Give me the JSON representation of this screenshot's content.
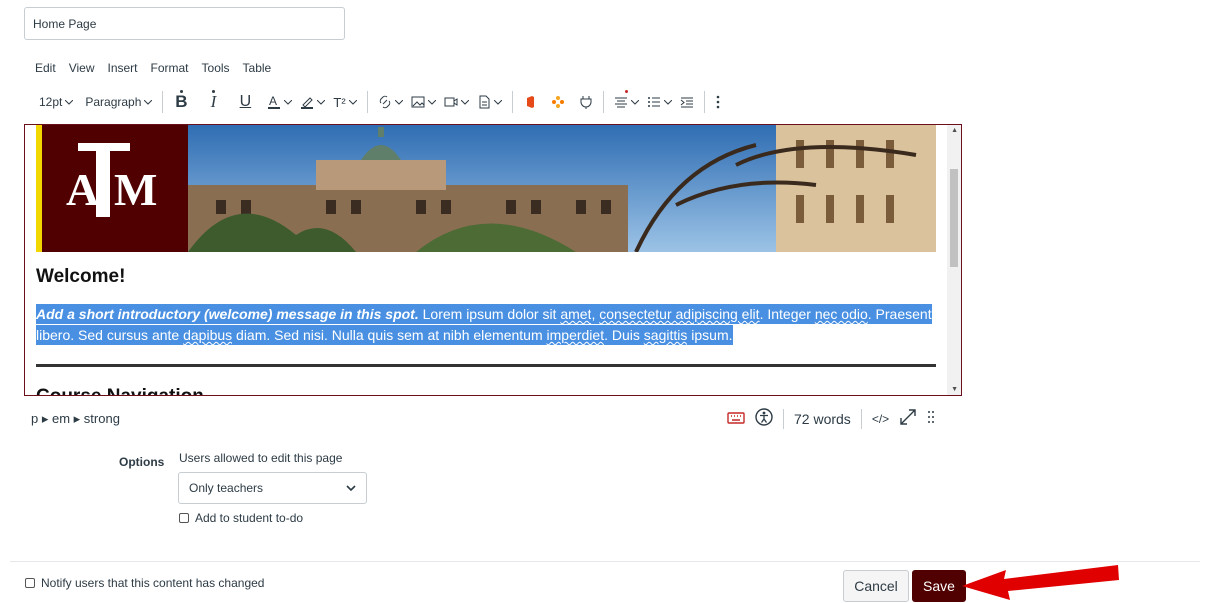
{
  "title_input": {
    "value": "Home Page"
  },
  "menubar": [
    "Edit",
    "View",
    "Insert",
    "Format",
    "Tools",
    "Table"
  ],
  "toolbar": {
    "font_size": "12pt",
    "block_format": "Paragraph",
    "superscript": "T²"
  },
  "content": {
    "heading": "Welcome!",
    "lead": "Add a short introductory (welcome) message in this spot.",
    "text_1": " Lorem ipsum dolor sit ",
    "text_2": "amet",
    "text_3": ", ",
    "text_4": "consectetur adipiscing elit",
    "text_5": ". Integer ",
    "text_6": "nec odio",
    "text_7": ". Praesent libero. Sed cursus ante ",
    "text_8": "dapibus",
    "text_9": " diam. Sed nisi. Nulla quis sem at nibh elementum ",
    "text_10": "imperdiet",
    "text_11": ". Duis ",
    "text_12": "sagittis",
    "text_13": " ipsum.",
    "next_heading": "Course Navigation"
  },
  "statusbar": {
    "path": "p ▸ em ▸ strong",
    "word_count": "72 words",
    "html_toggle": "</>"
  },
  "options": {
    "label": "Options",
    "edit_desc": "Users allowed to edit this page",
    "edit_select": "Only teachers",
    "todo_label": "Add to student to-do"
  },
  "footer": {
    "notify_label": "Notify users that this content has changed",
    "cancel": "Cancel",
    "save": "Save"
  },
  "colors": {
    "maroon": "#500000",
    "selection": "#4a90e2",
    "arrow": "#e00000"
  }
}
